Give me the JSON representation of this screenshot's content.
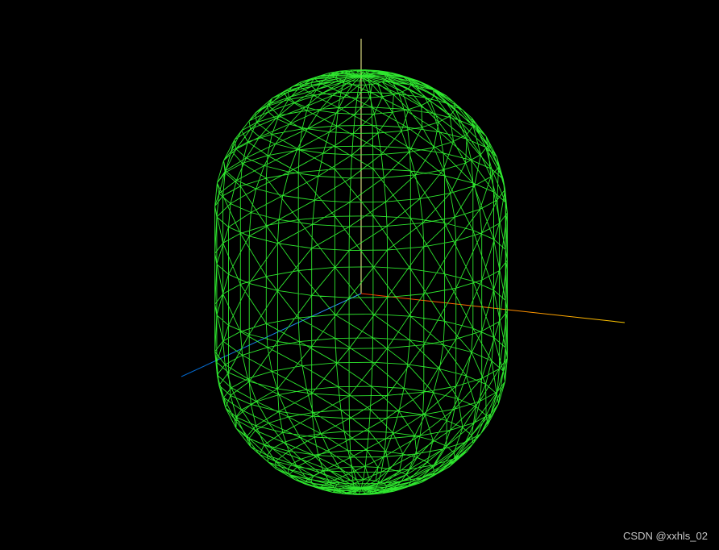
{
  "watermark": "CSDN @xxhls_02",
  "colors": {
    "background": "#000000",
    "mesh": "#33ff33",
    "axis_y": "#ffff99",
    "axis_x_start": "#ff3300",
    "axis_x_end": "#ffcc00",
    "axis_z_start": "#3399ff",
    "axis_z_end": "#0066cc"
  },
  "scene": {
    "object": "capsule-wireframe",
    "axes_helper": true
  }
}
